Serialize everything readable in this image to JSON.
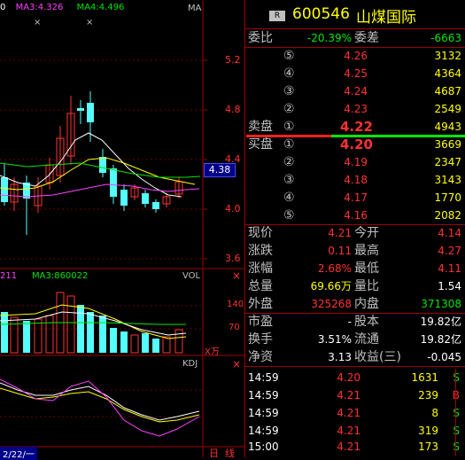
{
  "chart_header": {
    "ma_prefix": "0",
    "ma3_label": "MA3:4.326",
    "ma4_label": "MA4:4.496",
    "ma_tag": "MA",
    "price_ticks": [
      "5.2",
      "4.8",
      "4.4",
      "4.0",
      "3.6"
    ],
    "current_price_marker": "4.38",
    "x_markers": [
      "×",
      "×"
    ]
  },
  "vol_panel": {
    "left_label": "211",
    "ma3_label": "MA3:860022",
    "tag": "VOL",
    "ticks": [
      "140",
      "70"
    ],
    "unit": "X万"
  },
  "kdj_panel": {
    "tag": "KDJ",
    "date_label": "2/22/一"
  },
  "bottom_tabs": [
    "日",
    "线"
  ],
  "stock": {
    "badge": "R",
    "code": "600546",
    "name": "山煤国际"
  },
  "order_ratio": {
    "wb_label": "委比",
    "wb_value": "-20.39%",
    "wc_label": "委差",
    "wc_value": "-6663"
  },
  "asks": [
    {
      "level": "⑤",
      "price": "4.26",
      "volume": "3132"
    },
    {
      "level": "④",
      "price": "4.25",
      "volume": "4364"
    },
    {
      "level": "③",
      "price": "4.24",
      "volume": "4687"
    },
    {
      "level": "②",
      "price": "4.23",
      "volume": "2549"
    },
    {
      "level": "①",
      "price": "4.22",
      "volume": "4943"
    }
  ],
  "ask_label": "卖盘",
  "bid_label": "买盘",
  "bids": [
    {
      "level": "①",
      "price": "4.20",
      "volume": "3669"
    },
    {
      "level": "②",
      "price": "4.19",
      "volume": "2347"
    },
    {
      "level": "③",
      "price": "4.18",
      "volume": "3143"
    },
    {
      "level": "④",
      "price": "4.17",
      "volume": "1770"
    },
    {
      "level": "⑤",
      "price": "4.16",
      "volume": "2082"
    }
  ],
  "stats": [
    {
      "l1": "现价",
      "v1": "4.21",
      "l2": "今开",
      "v2": "4.14"
    },
    {
      "l1": "涨跌",
      "v1": "0.11",
      "l2": "最高",
      "v2": "4.27"
    },
    {
      "l1": "涨幅",
      "v1": "2.68%",
      "l2": "最低",
      "v2": "4.11"
    },
    {
      "l1": "总量",
      "v1": "69.66万",
      "l2": "量比",
      "v2": "1.54"
    },
    {
      "l1": "外盘",
      "v1": "325268",
      "l2": "内盘",
      "v2": "371308"
    }
  ],
  "fund": [
    {
      "l1": "市盈",
      "v1": "-",
      "l2": "股本",
      "v2": "19.82亿"
    },
    {
      "l1": "换手",
      "v1": "3.51%",
      "l2": "流通",
      "v2": "19.82亿"
    },
    {
      "l1": "净资",
      "v1": "3.13",
      "l2": "收益(三)",
      "v2": "-0.045"
    }
  ],
  "ticks": [
    {
      "time": "14:59",
      "price": "4.20",
      "vol": "1631",
      "side": "S"
    },
    {
      "time": "14:59",
      "price": "4.21",
      "vol": "239",
      "side": "B"
    },
    {
      "time": "14:59",
      "price": "4.21",
      "vol": "8",
      "side": "S"
    },
    {
      "time": "14:59",
      "price": "4.21",
      "vol": "319",
      "side": "S"
    },
    {
      "time": "15:00",
      "price": "4.21",
      "vol": "173",
      "side": "S"
    }
  ],
  "colors": {
    "up": "#ff3232",
    "down": "#00e600",
    "bull_candle": "#ff3232",
    "bear_candle": "#54fcfc",
    "ma_white": "#ffffff",
    "ma_yellow": "#ffff00",
    "ma_magenta": "#ff40ff",
    "ma_green": "#00e600"
  }
}
